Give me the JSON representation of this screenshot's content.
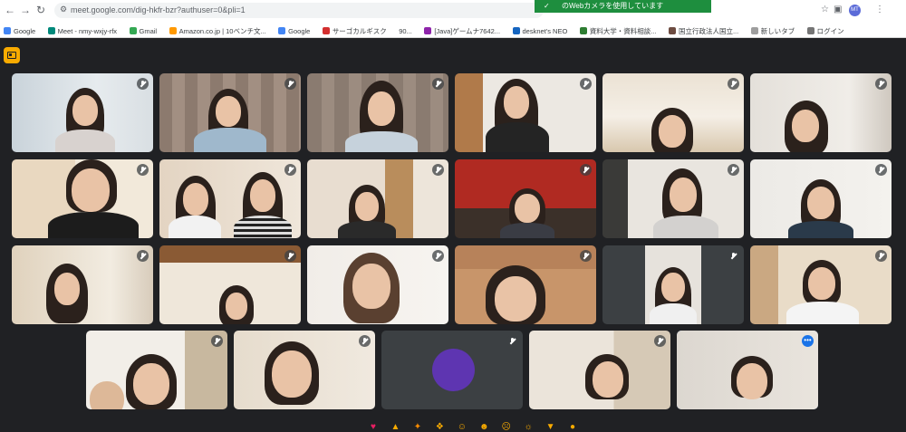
{
  "browser": {
    "back_icon": "arrow-left-icon",
    "forward_icon": "arrow-right-icon",
    "reload_icon": "reload-icon",
    "url": "meet.google.com/dig-hkfr-bzr?authuser=0&pli=1",
    "camera_toast": "のWebカメラを使用しています",
    "profile_initials": "MT",
    "bookmarks": [
      "Google",
      "Meet - nmy-wxjy-rfx",
      "Gmail",
      "Amazon.co.jp | 10ベンチ文...",
      "Google",
      "サーゴカルギスク",
      "90...",
      "[Java]ゲームナ7642...",
      "desknet's NEO",
      "資料大学・資料相談...",
      "国立行政法人国立...",
      "新しいタブ",
      "ログイン"
    ]
  },
  "meet": {
    "reactions": [
      "sparkling-heart",
      "thumbs-up",
      "party-popper",
      "clapping-hands",
      "tears-of-joy",
      "surprised",
      "crying",
      "thinking",
      "thumbs-down",
      "sun"
    ]
  },
  "colors": {
    "meet_background": "#202124",
    "toggle_yellow": "#f9ab00",
    "active_outline": "#8ab4f8",
    "avatar_purple": "#5e35b1",
    "toast_green": "#1e8e3e"
  }
}
